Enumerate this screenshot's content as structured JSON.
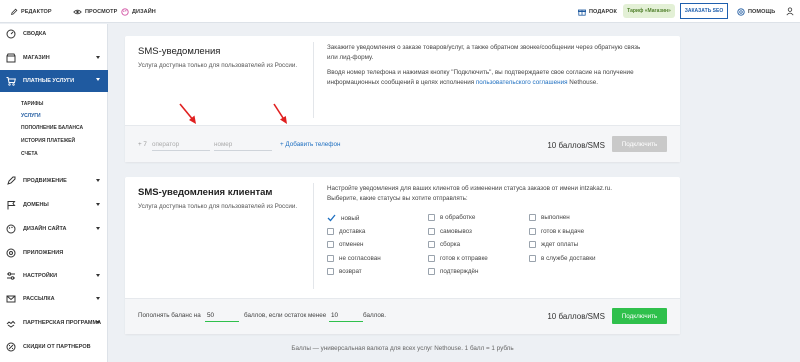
{
  "topbar": {
    "editor": "Редактор",
    "preview": "Просмотр",
    "design": "Дизайн",
    "gift": "Подарок",
    "tariff": "Тариф «Магазин»",
    "seo_button": "Заказать SEO",
    "help": "Помощь"
  },
  "sidebar": {
    "items": [
      {
        "label": "Сводка",
        "icon": "gauge-icon"
      },
      {
        "label": "Магазин",
        "icon": "store-icon"
      },
      {
        "label": "Платные услуги",
        "icon": "cart-icon"
      },
      {
        "label": "Продвижение",
        "icon": "rocket-icon"
      },
      {
        "label": "Домены",
        "icon": "flag-icon"
      },
      {
        "label": "Дизайн сайта",
        "icon": "palette-icon"
      },
      {
        "label": "Приложения",
        "icon": "apps-icon"
      },
      {
        "label": "Настройки",
        "icon": "sliders-icon"
      },
      {
        "label": "Рассылка",
        "icon": "mail-icon"
      },
      {
        "label": "Партнерская программа",
        "icon": "partner-icon"
      },
      {
        "label": "Скидки от партнеров",
        "icon": "discount-icon"
      }
    ],
    "subitems": [
      "Тарифы",
      "Услуги",
      "Пополнение баланса",
      "История платежей",
      "Счета"
    ]
  },
  "sms_card": {
    "title": "SMS-уведомления",
    "subtitle": "Услуга доступна только для пользователей из России.",
    "desc_line1": "Закажите уведомления о заказе товаров/услуг, а также обратном звонке/сообщении через обратную связь",
    "desc_line2": "или лид-форму.",
    "desc_line3": "Вводя номер телефона и нажимая кнопку \"Подключить\", вы подтверждаете свое согласие на получение",
    "desc_line4_prefix": "информационных сообщений в целях исполнения",
    "desc_link": "пользовательского соглашения",
    "desc_line4_suffix": "Nethouse.",
    "phone_prefix": "+ 7",
    "operator_placeholder": "оператор",
    "number_placeholder": "номер",
    "add_phone": "+ Добавить телефон",
    "price": "10 баллов/SMS",
    "connect": "Подключить"
  },
  "client_card": {
    "title": "SMS-уведомления клиентам",
    "subtitle": "Услуга доступна только для пользователей из России.",
    "desc_line1": "Настройте уведомления для ваших клиентов об изменении статуса заказов от имени intzakaz.ru.",
    "desc_line2": "Выберите, какие статусы вы хотите отправлять:",
    "statuses": [
      {
        "label": "новый",
        "checked": true
      },
      {
        "label": "в обработке",
        "checked": false
      },
      {
        "label": "выполнен",
        "checked": false
      },
      {
        "label": "доставка",
        "checked": false
      },
      {
        "label": "самовывоз",
        "checked": false
      },
      {
        "label": "готов к выдаче",
        "checked": false
      },
      {
        "label": "отменен",
        "checked": false
      },
      {
        "label": "сборка",
        "checked": false
      },
      {
        "label": "ждет оплаты",
        "checked": false
      },
      {
        "label": "не согласован",
        "checked": false
      },
      {
        "label": "готов к отправке",
        "checked": false
      },
      {
        "label": "в службе доставки",
        "checked": false
      },
      {
        "label": "возврат",
        "checked": false
      },
      {
        "label": "подтверждён",
        "checked": false
      }
    ],
    "balance_prefix": "Пополнять баланс на",
    "balance_amount": "50",
    "balance_mid": "баллов, если остаток менее",
    "balance_threshold": "10",
    "balance_suffix": "баллов.",
    "price": "10 баллов/SMS",
    "connect": "Подключить"
  },
  "bottom_note": "Баллы — универсальная валюта для всех услуг Nethouse. 1 балл = 1 рубль",
  "colors": {
    "primary": "#1f5aa0",
    "green": "#2fc04c",
    "link": "#1e6fc0",
    "annotation_arrow": "#e02020"
  }
}
